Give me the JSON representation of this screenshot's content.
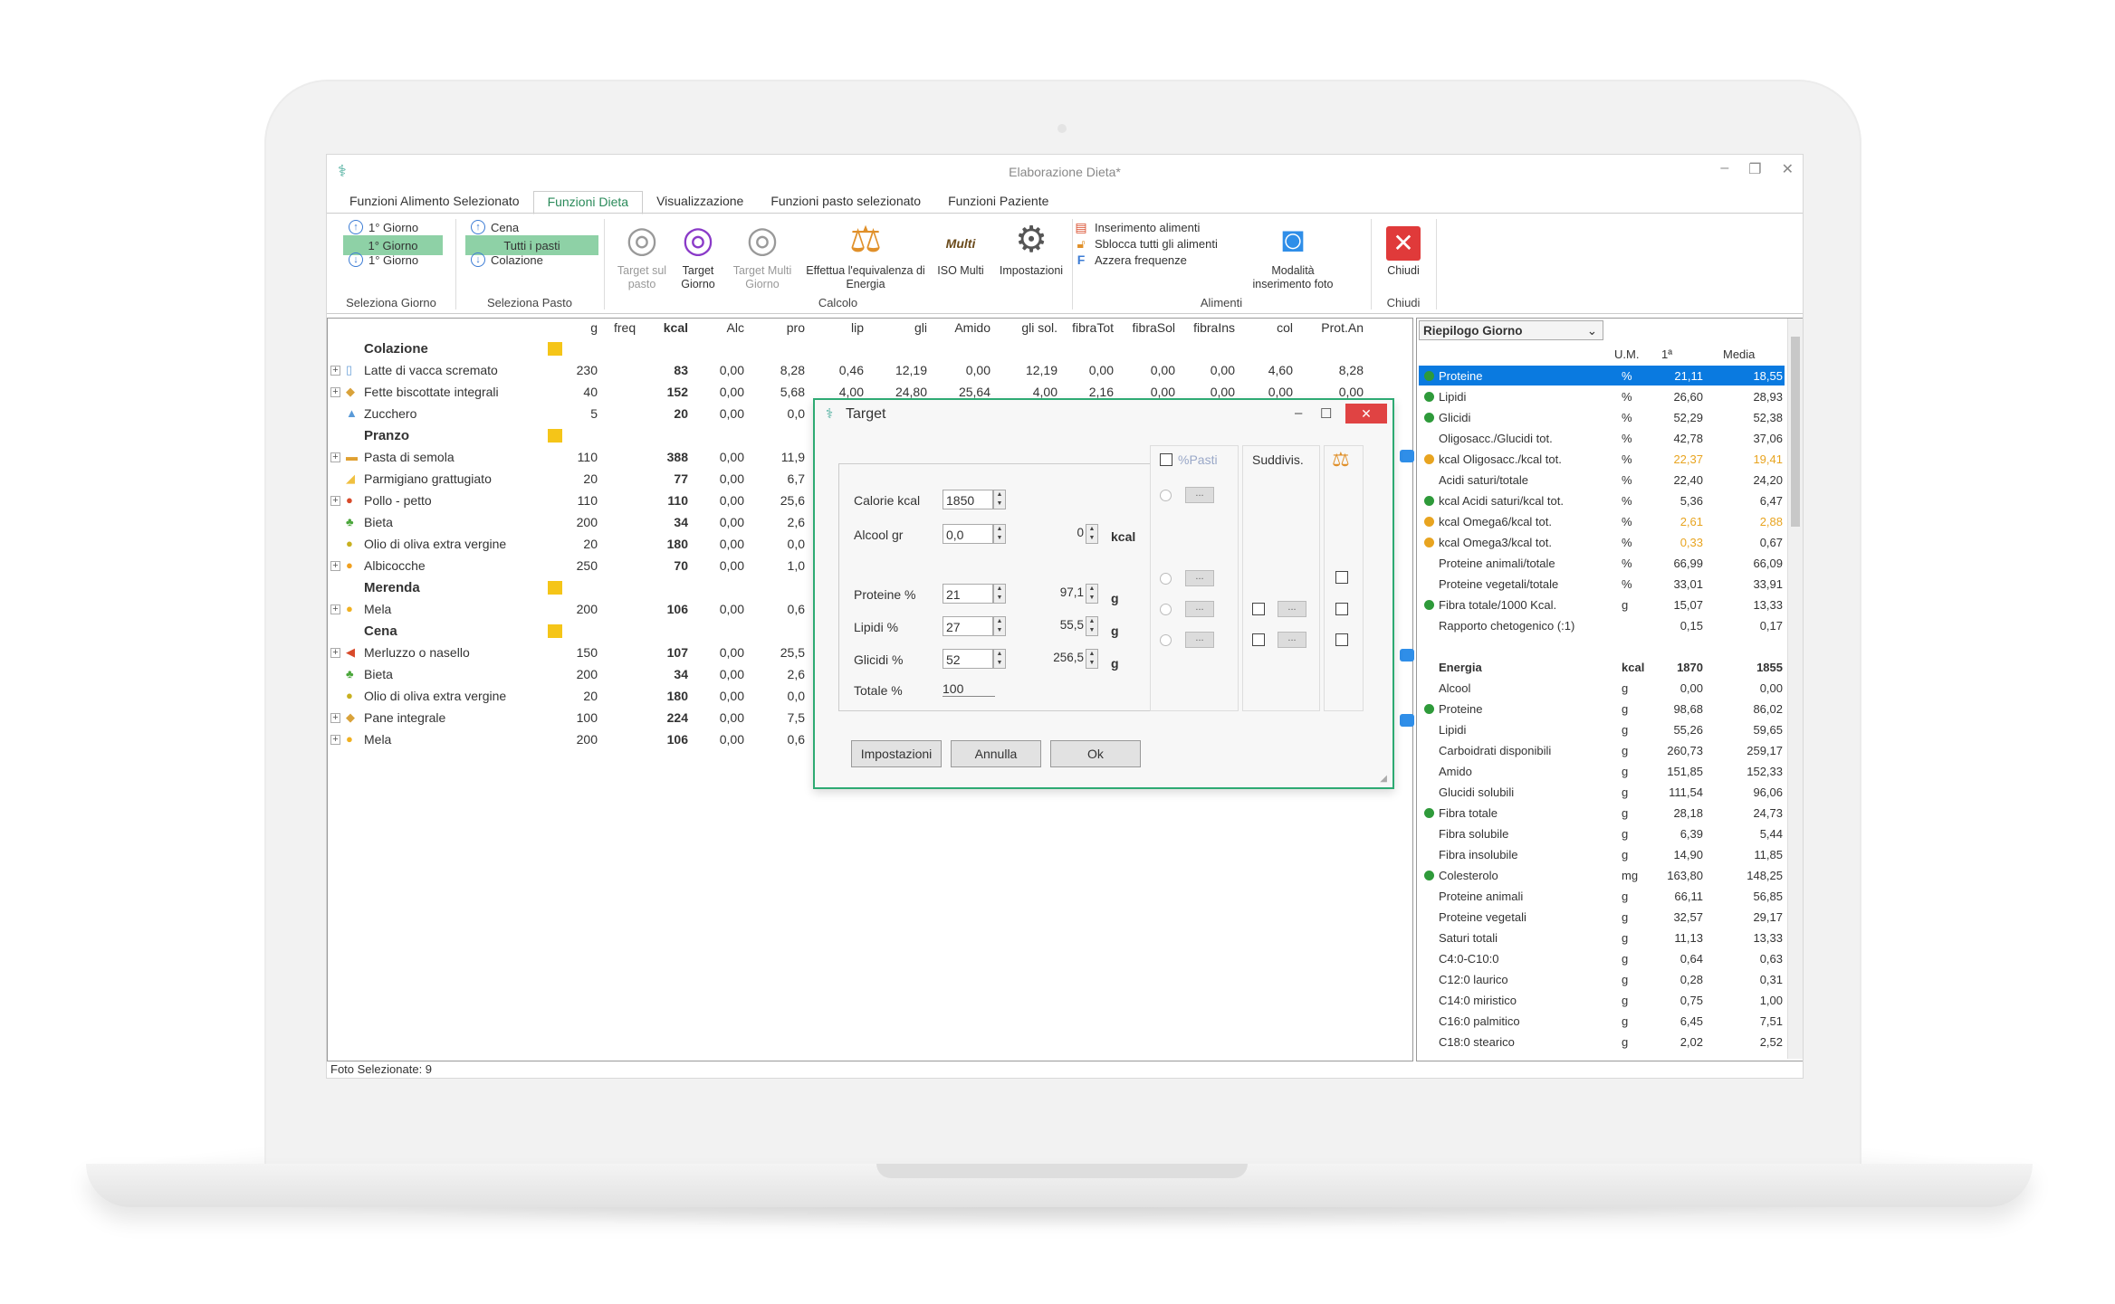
{
  "window": {
    "title": "Elaborazione Dieta*"
  },
  "tabs": [
    "Funzioni Alimento Selezionato",
    "Funzioni Dieta",
    "Visualizzazione",
    "Funzioni pasto selezionato",
    "Funzioni Paziente"
  ],
  "ribbon": {
    "giorno": {
      "prev": "1° Giorno",
      "current": "1° Giorno",
      "next": "1° Giorno",
      "label": "Seleziona Giorno"
    },
    "pasto": {
      "prev": "Cena",
      "current": "Tutti i pasti",
      "next": "Colazione",
      "label": "Seleziona Pasto"
    },
    "calcolo": {
      "label": "Calcolo",
      "target_pasto": "Target sul pasto",
      "target_giorno": "Target Giorno",
      "target_multi": "Target Multi Giorno",
      "equivalenza": "Effettua l'equivalenza di Energia",
      "iso_multi": "ISO Multi",
      "iso_multi_icon_text": "Multi",
      "impostazioni": "Impostazioni"
    },
    "alimenti": {
      "label": "Alimenti",
      "inserimento": "Inserimento alimenti",
      "sblocca": "Sblocca tutti gli alimenti",
      "azzera": "Azzera frequenze",
      "modalita_foto": "Modalità inserimento foto"
    },
    "chiudi": {
      "label": "Chiudi",
      "button": "Chiudi"
    }
  },
  "grid": {
    "headers": [
      "g",
      "freq",
      "kcal",
      "Alc",
      "pro",
      "lip",
      "gli",
      "Amido",
      "gli sol.",
      "fibraTot",
      "fibraSol",
      "fibraIns",
      "col",
      "Prot.An"
    ],
    "rows": [
      {
        "type": "meal",
        "name": "Colazione"
      },
      {
        "type": "food",
        "name": "Latte di vacca scremato",
        "g": "230",
        "kcal": "83",
        "alc": "0,00",
        "pro": "8,28",
        "lip": "0,46",
        "gli": "12,19",
        "amido": "0,00",
        "glisol": "12,19",
        "fibtot": "0,00",
        "fibsol": "0,00",
        "fibins": "0,00",
        "col": "4,60",
        "protan": "8,28",
        "exp": true,
        "icon": "milk-icon",
        "glyph": "▯",
        "color": "#6aa0d8"
      },
      {
        "type": "food",
        "name": "Fette biscottate integrali",
        "g": "40",
        "kcal": "152",
        "alc": "0,00",
        "pro": "5,68",
        "lip": "4,00",
        "gli": "24,80",
        "amido": "25,64",
        "glisol": "4,00",
        "fibtot": "2,16",
        "fibsol": "0,00",
        "fibins": "0,00",
        "col": "0,00",
        "protan": "0,00",
        "exp": true,
        "icon": "bread-icon",
        "glyph": "◆",
        "color": "#d9a23a"
      },
      {
        "type": "food",
        "name": "Zucchero",
        "g": "5",
        "kcal": "20",
        "alc": "0,00",
        "pro": "0,0",
        "exp": false,
        "icon": "sugar-icon",
        "glyph": "▲",
        "color": "#5a9ad8"
      },
      {
        "type": "meal",
        "name": "Pranzo"
      },
      {
        "type": "food",
        "name": "Pasta di semola",
        "g": "110",
        "kcal": "388",
        "alc": "0,00",
        "pro": "11,9",
        "exp": true,
        "icon": "pasta-icon",
        "glyph": "▬",
        "color": "#e0a030"
      },
      {
        "type": "food",
        "name": "Parmigiano grattugiato",
        "g": "20",
        "kcal": "77",
        "alc": "0,00",
        "pro": "6,7",
        "exp": false,
        "icon": "cheese-icon",
        "glyph": "◢",
        "color": "#f0c040"
      },
      {
        "type": "food",
        "name": "Pollo - petto",
        "g": "110",
        "kcal": "110",
        "alc": "0,00",
        "pro": "25,6",
        "exp": true,
        "icon": "chicken-icon",
        "glyph": "●",
        "color": "#d84a2a"
      },
      {
        "type": "food",
        "name": "Bieta",
        "g": "200",
        "kcal": "34",
        "alc": "0,00",
        "pro": "2,6",
        "exp": false,
        "icon": "vegetable-icon",
        "glyph": "♣",
        "color": "#4aa63a"
      },
      {
        "type": "food",
        "name": "Olio di oliva extra vergine",
        "g": "20",
        "kcal": "180",
        "alc": "0,00",
        "pro": "0,0",
        "exp": false,
        "icon": "oil-icon",
        "glyph": "●",
        "color": "#c8b020"
      },
      {
        "type": "food",
        "name": "Albicocche",
        "g": "250",
        "kcal": "70",
        "alc": "0,00",
        "pro": "1,0",
        "exp": true,
        "icon": "fruit-icon",
        "glyph": "●",
        "color": "#f0a020"
      },
      {
        "type": "meal",
        "name": "Merenda"
      },
      {
        "type": "food",
        "name": "Mela",
        "g": "200",
        "kcal": "106",
        "alc": "0,00",
        "pro": "0,6",
        "exp": true,
        "icon": "apple-icon",
        "glyph": "●",
        "color": "#f0b020"
      },
      {
        "type": "meal",
        "name": "Cena"
      },
      {
        "type": "food",
        "name": "Merluzzo o nasello",
        "g": "150",
        "kcal": "107",
        "alc": "0,00",
        "pro": "25,5",
        "exp": true,
        "icon": "fish-icon",
        "glyph": "◀",
        "color": "#d84a2a"
      },
      {
        "type": "food",
        "name": "Bieta",
        "g": "200",
        "kcal": "34",
        "alc": "0,00",
        "pro": "2,6",
        "exp": false,
        "icon": "vegetable-icon",
        "glyph": "♣",
        "color": "#4aa63a"
      },
      {
        "type": "food",
        "name": "Olio di oliva extra vergine",
        "g": "20",
        "kcal": "180",
        "alc": "0,00",
        "pro": "0,0",
        "exp": false,
        "icon": "oil-icon",
        "glyph": "●",
        "color": "#c8b020"
      },
      {
        "type": "food",
        "name": "Pane integrale",
        "g": "100",
        "kcal": "224",
        "alc": "0,00",
        "pro": "7,5",
        "exp": true,
        "icon": "bread-icon",
        "glyph": "◆",
        "color": "#d9a23a"
      },
      {
        "type": "food",
        "name": "Mela",
        "g": "200",
        "kcal": "106",
        "alc": "0,00",
        "pro": "0,6",
        "exp": true,
        "icon": "apple-icon",
        "glyph": "●",
        "color": "#f0b020"
      }
    ]
  },
  "summary": {
    "dropdown": "Riepilogo Giorno",
    "col_um": "U.M.",
    "col_1": "1ª",
    "col_media": "Media",
    "rows": [
      {
        "name": "Proteine",
        "um": "%",
        "v1": "21,11",
        "media": "18,55",
        "dot": "#2e9a3a",
        "sel": true
      },
      {
        "name": "Lipidi",
        "um": "%",
        "v1": "26,60",
        "media": "28,93",
        "dot": "#2e9a3a"
      },
      {
        "name": "Glicidi",
        "um": "%",
        "v1": "52,29",
        "media": "52,38",
        "dot": "#2e9a3a"
      },
      {
        "name": "Oligosacc./Glucidi tot.",
        "um": "%",
        "v1": "42,78",
        "media": "37,06"
      },
      {
        "name": "kcal Oligosacc./kcal tot.",
        "um": "%",
        "v1": "22,37",
        "media": "19,41",
        "dot": "#e8a420",
        "warn": true
      },
      {
        "name": "Acidi saturi/totale",
        "um": "%",
        "v1": "22,40",
        "media": "24,20"
      },
      {
        "name": "kcal Acidi saturi/kcal tot.",
        "um": "%",
        "v1": "5,36",
        "media": "6,47",
        "dot": "#2e9a3a"
      },
      {
        "name": "kcal Omega6/kcal tot.",
        "um": "%",
        "v1": "2,61",
        "media": "2,88",
        "dot": "#e8a420",
        "warn": true
      },
      {
        "name": "kcal Omega3/kcal tot.",
        "um": "%",
        "v1": "0,33",
        "media": "0,67",
        "dot": "#e8a420",
        "warn1": true
      },
      {
        "name": "Proteine animali/totale",
        "um": "%",
        "v1": "66,99",
        "media": "66,09"
      },
      {
        "name": "Proteine vegetali/totale",
        "um": "%",
        "v1": "33,01",
        "media": "33,91"
      },
      {
        "name": "Fibra totale/1000 Kcal.",
        "um": "g",
        "v1": "15,07",
        "media": "13,33",
        "dot": "#2e9a3a"
      },
      {
        "name": "Rapporto chetogenico (:1)",
        "um": "",
        "v1": "0,15",
        "media": "0,17"
      },
      {
        "blank": true
      },
      {
        "name": "Energia",
        "um": "kcal",
        "v1": "1870",
        "media": "1855",
        "bold": true
      },
      {
        "name": "Alcool",
        "um": "g",
        "v1": "0,00",
        "media": "0,00"
      },
      {
        "name": "Proteine",
        "um": "g",
        "v1": "98,68",
        "media": "86,02",
        "dot": "#2e9a3a"
      },
      {
        "name": "Lipidi",
        "um": "g",
        "v1": "55,26",
        "media": "59,65"
      },
      {
        "name": "Carboidrati disponibili",
        "um": "g",
        "v1": "260,73",
        "media": "259,17"
      },
      {
        "name": "Amido",
        "um": "g",
        "v1": "151,85",
        "media": "152,33"
      },
      {
        "name": "Glucidi solubili",
        "um": "g",
        "v1": "111,54",
        "media": "96,06"
      },
      {
        "name": "Fibra totale",
        "um": "g",
        "v1": "28,18",
        "media": "24,73",
        "dot": "#2e9a3a"
      },
      {
        "name": "Fibra solubile",
        "um": "g",
        "v1": "6,39",
        "media": "5,44"
      },
      {
        "name": "Fibra insolubile",
        "um": "g",
        "v1": "14,90",
        "media": "11,85"
      },
      {
        "name": "Colesterolo",
        "um": "mg",
        "v1": "163,80",
        "media": "148,25",
        "dot": "#2e9a3a"
      },
      {
        "name": "Proteine animali",
        "um": "g",
        "v1": "66,11",
        "media": "56,85"
      },
      {
        "name": "Proteine vegetali",
        "um": "g",
        "v1": "32,57",
        "media": "29,17"
      },
      {
        "name": "Saturi totali",
        "um": "g",
        "v1": "11,13",
        "media": "13,33"
      },
      {
        "name": "C4:0-C10:0",
        "um": "g",
        "v1": "0,64",
        "media": "0,63"
      },
      {
        "name": "C12:0 laurico",
        "um": "g",
        "v1": "0,28",
        "media": "0,31"
      },
      {
        "name": "C14:0 miristico",
        "um": "g",
        "v1": "0,75",
        "media": "1,00"
      },
      {
        "name": "C16:0 palmitico",
        "um": "g",
        "v1": "6,45",
        "media": "7,51"
      },
      {
        "name": "C18:0 stearico",
        "um": "g",
        "v1": "2,02",
        "media": "2,52"
      }
    ]
  },
  "status": "Foto Selezionate: 9",
  "dialog": {
    "title": "Target",
    "calorie_label": "Calorie kcal",
    "calorie_value": "1850",
    "alcool_label": "Alcool gr",
    "alcool_value": "0,0",
    "alcool_kcal": "0",
    "kcal_unit": "kcal",
    "proteine_label": "Proteine %",
    "proteine_value": "21",
    "proteine_g": "97,1",
    "lipidi_label": "Lipidi %",
    "lipidi_value": "27",
    "lipidi_g": "55,5",
    "glicidi_label": "Glicidi %",
    "glicidi_value": "52",
    "glicidi_g": "256,5",
    "g_unit": "g",
    "totale_label": "Totale %",
    "totale_value": "100",
    "pasti_label": "%Pasti",
    "suddivis_label": "Suddivis.",
    "dots": "...",
    "btn_impostazioni": "Impostazioni",
    "btn_annulla": "Annulla",
    "btn_ok": "Ok"
  }
}
